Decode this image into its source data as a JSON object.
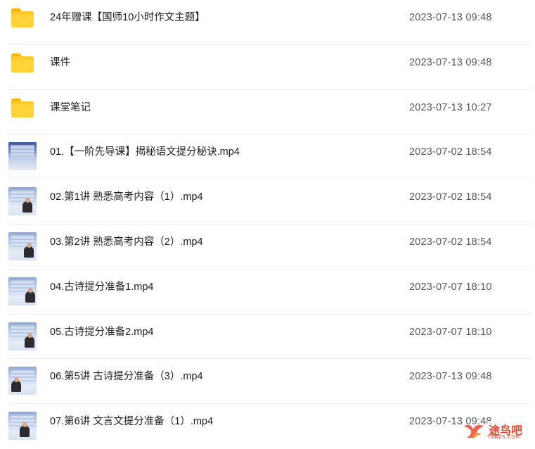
{
  "files": [
    {
      "type": "folder",
      "name": "24年赠课【国师10小时作文主题】",
      "date": "2023-07-13 09:48"
    },
    {
      "type": "folder",
      "name": "课件",
      "date": "2023-07-13 09:48"
    },
    {
      "type": "folder",
      "name": "课堂笔记",
      "date": "2023-07-13 10:27"
    },
    {
      "type": "video",
      "name": "01.【一阶先导课】揭秘语文提分秘诀.mp4",
      "date": "2023-07-02 18:54"
    },
    {
      "type": "video",
      "name": "02.第1讲 熟悉高考内容（1）.mp4",
      "date": "2023-07-02 18:54"
    },
    {
      "type": "video",
      "name": "03.第2讲 熟悉高考内容（2）.mp4",
      "date": "2023-07-02 18:54"
    },
    {
      "type": "video",
      "name": "04.古诗提分准备1.mp4",
      "date": "2023-07-07 18:10"
    },
    {
      "type": "video",
      "name": "05.古诗提分准备2.mp4",
      "date": "2023-07-07 18:10"
    },
    {
      "type": "video",
      "name": "06.第5讲 古诗提分准备（3）.mp4",
      "date": "2023-07-13 09:48"
    },
    {
      "type": "video",
      "name": "07.第6讲 文言文提分准备（1）.mp4",
      "date": "2023-07-13 09:48"
    }
  ],
  "watermark": {
    "text": "途鸟吧",
    "sub": "TNBZS.COM",
    "icon": "bird-logo-icon",
    "color": "#e8462f"
  },
  "colors": {
    "folder": "#fbc926",
    "text": "#1d1d22",
    "date": "#555861",
    "divider": "#eceef2"
  }
}
